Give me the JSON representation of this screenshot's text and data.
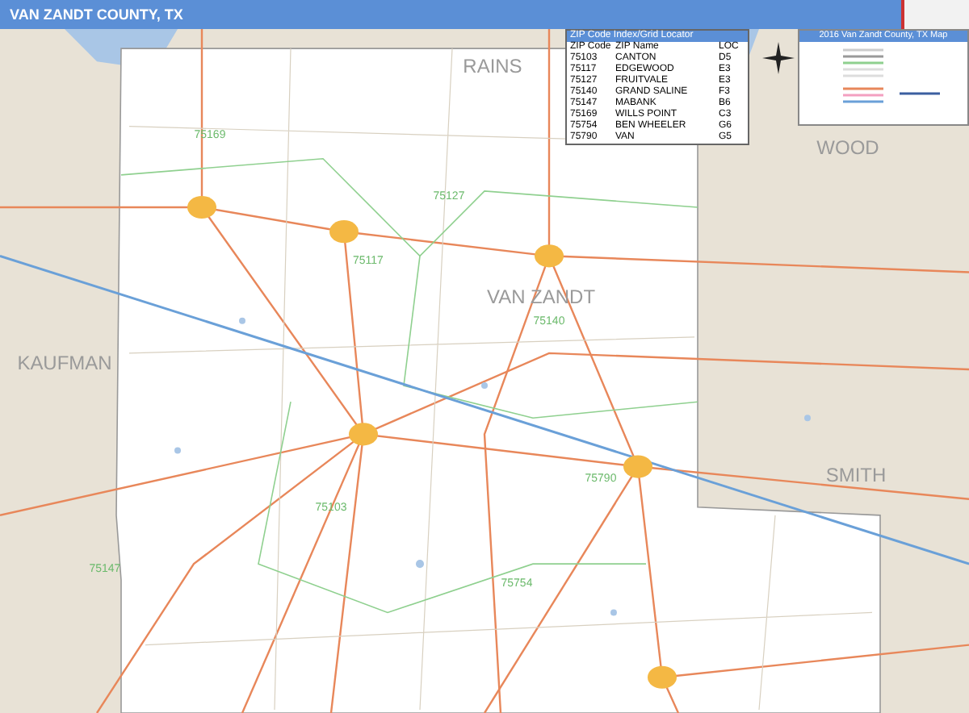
{
  "title": "VAN ZANDT COUNTY, TX",
  "zip_index": {
    "title": "ZIP Code Index/Grid Locator",
    "columns": [
      "ZIP Code",
      "ZIP Name",
      "LOC"
    ],
    "rows": [
      [
        "75103",
        "CANTON",
        "D5"
      ],
      [
        "75117",
        "EDGEWOOD",
        "E3"
      ],
      [
        "75127",
        "FRUITVALE",
        "E3"
      ],
      [
        "75140",
        "GRAND SALINE",
        "F3"
      ],
      [
        "75147",
        "MABANK",
        "B6"
      ],
      [
        "75169",
        "WILLS POINT",
        "C3"
      ],
      [
        "75754",
        "BEN WHEELER",
        "G6"
      ],
      [
        "75790",
        "VAN",
        "G5"
      ]
    ]
  },
  "legend": {
    "title": "2016 Van Zandt County, TX Map"
  },
  "county_labels": [
    "RAINS",
    "WOOD",
    "KAUFMAN",
    "SMITH",
    "VAN ZANDT"
  ],
  "zip_labels": [
    "75169",
    "75127",
    "75117",
    "75140",
    "75103",
    "75790",
    "75754",
    "75147"
  ]
}
